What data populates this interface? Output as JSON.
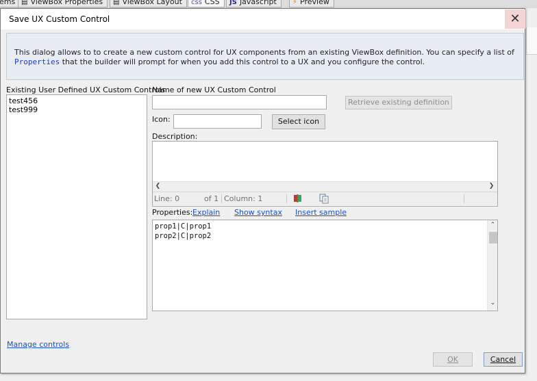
{
  "background_tabs": [
    {
      "label": "ems",
      "icon": ""
    },
    {
      "label": "ViewBox Properties",
      "icon": "▤"
    },
    {
      "label": "ViewBox Layout",
      "icon": "▤"
    },
    {
      "label": "CSS",
      "icon": "css"
    },
    {
      "label": "Javascript",
      "icon": "JS"
    },
    {
      "label": "Preview",
      "icon": "⚡"
    }
  ],
  "dialog": {
    "title": "Save UX Custom Control",
    "close_glyph": "✕",
    "info_text_before": "This dialog allows to to create a new custom control for UX components from an existing ViewBox definition. You can specify a list of ",
    "info_keyword": "Properties",
    "info_text_after": " that the builder will prompt for when you add this control to a UX and you configure the control."
  },
  "existing": {
    "label": "Existing User Defined UX Custom Controls",
    "items": [
      "test456",
      "test999"
    ]
  },
  "form": {
    "name_label": "Name of new UX Custom Control",
    "name_value": "",
    "retrieve_button": "Retrieve existing definition",
    "icon_label": "Icon:",
    "icon_value": "",
    "select_icon_button": "Select icon",
    "description_label": "Description:",
    "description_value": "",
    "status": {
      "line": "Line: 0",
      "of": "of 1",
      "column": "Column: 1"
    },
    "properties_label": "Properties:",
    "explain_link": "Explain",
    "syntax_link": "Show syntax",
    "sample_link": "Insert sample",
    "properties_value": "prop1|C|prop1\nprop2|C|prop2"
  },
  "footer": {
    "manage_link": "Manage controls",
    "ok_button": "OK",
    "cancel_button": "Cancel"
  },
  "icons": {
    "book": "book-icon",
    "copy": "copy-icon"
  },
  "colors": {
    "close_bg": "#f4d3d3",
    "info_bg": "#e8edf3",
    "link": "#1a4fbf",
    "keyword": "#1f3bb5"
  }
}
